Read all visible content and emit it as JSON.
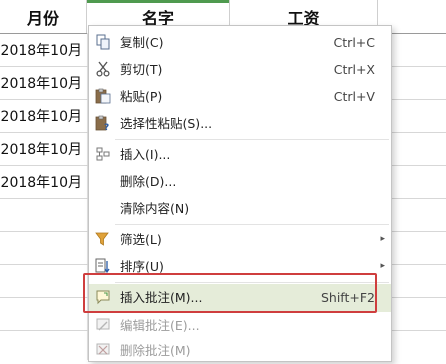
{
  "sheet": {
    "headers": {
      "month": "月份",
      "name": "名字",
      "wage": "工资"
    },
    "dates": [
      "2018年10月",
      "2018年10月",
      "2018年10月",
      "2018年10月",
      "2018年10月"
    ]
  },
  "menu": {
    "copy": {
      "label": "复制(C)",
      "shortcut": "Ctrl+C"
    },
    "cut": {
      "label": "剪切(T)",
      "shortcut": "Ctrl+X"
    },
    "paste": {
      "label": "粘贴(P)",
      "shortcut": "Ctrl+V"
    },
    "paste_special": {
      "label": "选择性粘贴(S)..."
    },
    "insert": {
      "label": "插入(I)..."
    },
    "delete": {
      "label": "删除(D)..."
    },
    "clear": {
      "label": "清除内容(N)"
    },
    "filter": {
      "label": "筛选(L)"
    },
    "sort": {
      "label": "排序(U)"
    },
    "insert_comment": {
      "label": "插入批注(M)...",
      "shortcut": "Shift+F2"
    },
    "edit_comment": {
      "label": "编辑批注(E)..."
    },
    "delete_comment": {
      "label": "删除批注(M)"
    }
  },
  "colors": {
    "highlight": "#e5ecd9",
    "red_box": "#cf3e3e",
    "header_accent": "#4f9a4f"
  }
}
